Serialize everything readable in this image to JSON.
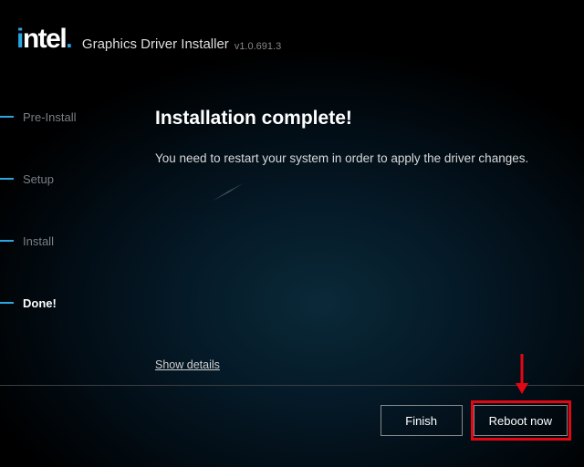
{
  "header": {
    "app_title": "Graphics Driver Installer",
    "version": "v1.0.691.3"
  },
  "sidebar": {
    "steps": {
      "pre_install": "Pre-Install",
      "setup": "Setup",
      "install": "Install",
      "done": "Done!"
    }
  },
  "main": {
    "title": "Installation complete!",
    "desc": "You need to restart your system in order to apply the driver changes.",
    "show_details": "Show details"
  },
  "buttons": {
    "finish": "Finish",
    "reboot": "Reboot now"
  }
}
